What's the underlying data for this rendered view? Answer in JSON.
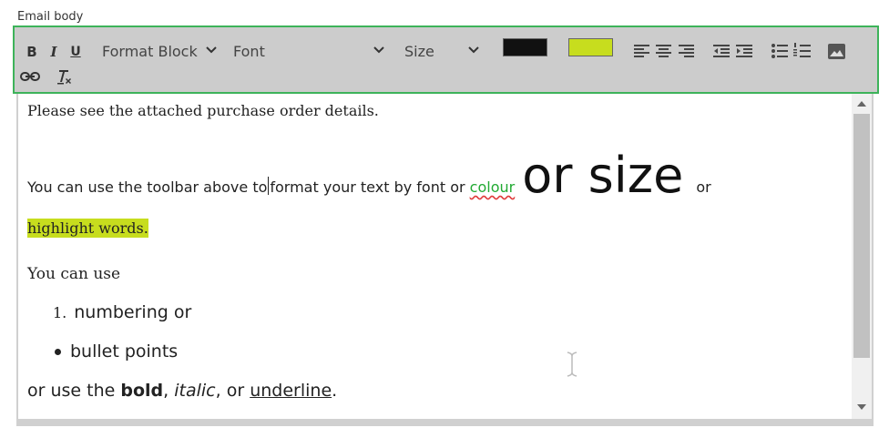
{
  "field_label": "Email body",
  "toolbar": {
    "bold_label": "B",
    "italic_label": "I",
    "underline_label": "U",
    "format_block": "Format Block",
    "font": "Font",
    "size": "Size",
    "text_color": "#111111",
    "highlight_color": "#c7dd1e"
  },
  "content": {
    "para1": "Please see the attached purchase order details.",
    "para2_a": "You can use the toolbar above to",
    "para2_b": "format your text by font or",
    "para2_colour": "colour",
    "para2_big": "or size",
    "para2_or": "or",
    "para3": "highlight words.",
    "para4": "You can use",
    "list_num": "1.",
    "list_item1": "numbering or",
    "list_item2": "bullet points",
    "p5_a": "or use the ",
    "p5_bold": "bold",
    "p5_b": ", ",
    "p5_italic": "italic",
    "p5_c": ", or ",
    "p5_underline": "underline",
    "p5_d": "."
  }
}
